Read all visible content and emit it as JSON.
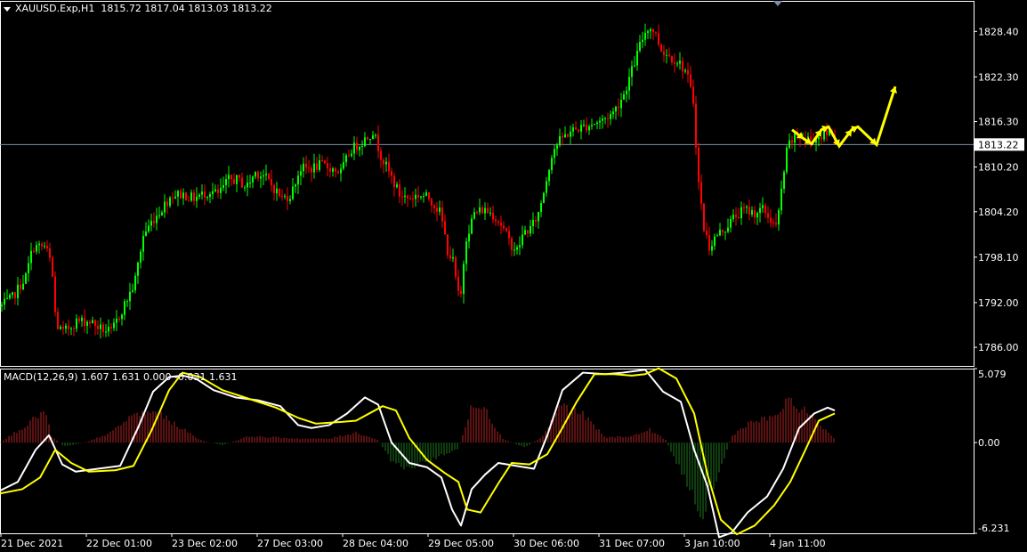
{
  "header": {
    "symbol": "XAUUSD.Exp,H1",
    "ohlc": "1815.72 1817.04 1813.03 1813.22"
  },
  "macd_header": {
    "text": "MACD(12,26,9) 1.607 1.631 0.000 -0.031 1.631"
  },
  "colors": {
    "background": "#000000",
    "bull": "#00ff00",
    "bear": "#ff0000",
    "macd_line": "#ffffff",
    "signal_line": "#ffff00",
    "hist_pos": "#b22222",
    "hist_neg": "#1e7a1e",
    "arrows": "#ffff00",
    "current_price_line": "#7f8fa6",
    "frame": "#ffffff"
  },
  "chart_data": [
    {
      "type": "candlestick",
      "title": "XAUUSD.Exp,H1",
      "ylim": [
        1783.5,
        1832.5
      ],
      "y_ticks": [
        "1828.40",
        "1822.30",
        "1816.30",
        "1810.20",
        "1804.20",
        "1798.10",
        "1792.00",
        "1786.00"
      ],
      "current_price": "1813.22",
      "x_ticks": [
        "21 Dec 2021",
        "22 Dec 01:00",
        "23 Dec 02:00",
        "27 Dec 03:00",
        "28 Dec 04:00",
        "29 Dec 05:00",
        "30 Dec 06:00",
        "31 Dec 07:00",
        "3 Jan 10:00",
        "4 Jan 11:00"
      ],
      "close_path": [
        [
          0,
          1791.5
        ],
        [
          12,
          1792.5
        ],
        [
          28,
          1795.5
        ],
        [
          36,
          1799.5
        ],
        [
          50,
          1799.5
        ],
        [
          57,
          1797.0
        ],
        [
          62,
          1789.0
        ],
        [
          70,
          1788.0
        ],
        [
          85,
          1789.5
        ],
        [
          100,
          1789.5
        ],
        [
          112,
          1788.5
        ],
        [
          124,
          1788.0
        ],
        [
          138,
          1791.5
        ],
        [
          150,
          1794.5
        ],
        [
          160,
          1801.0
        ],
        [
          170,
          1803.0
        ],
        [
          180,
          1804.5
        ],
        [
          192,
          1806.5
        ],
        [
          205,
          1806.5
        ],
        [
          216,
          1806.0
        ],
        [
          226,
          1806.5
        ],
        [
          236,
          1807.0
        ],
        [
          244,
          1806.5
        ],
        [
          256,
          1808.5
        ],
        [
          266,
          1808.5
        ],
        [
          276,
          1807.5
        ],
        [
          286,
          1809.5
        ],
        [
          296,
          1809.0
        ],
        [
          306,
          1807.5
        ],
        [
          316,
          1806.0
        ],
        [
          326,
          1806.5
        ],
        [
          336,
          1810.0
        ],
        [
          348,
          1810.0
        ],
        [
          360,
          1810.5
        ],
        [
          372,
          1810.0
        ],
        [
          382,
          1809.5
        ],
        [
          393,
          1812.5
        ],
        [
          405,
          1813.5
        ],
        [
          418,
          1815.0
        ],
        [
          428,
          1811.5
        ],
        [
          438,
          1809.0
        ],
        [
          448,
          1806.5
        ],
        [
          458,
          1806.0
        ],
        [
          470,
          1806.5
        ],
        [
          482,
          1806.0
        ],
        [
          494,
          1804.0
        ],
        [
          502,
          1799.0
        ],
        [
          508,
          1797.5
        ],
        [
          516,
          1791.5
        ],
        [
          522,
          1800.5
        ],
        [
          532,
          1804.0
        ],
        [
          542,
          1804.5
        ],
        [
          552,
          1804.0
        ],
        [
          562,
          1802.5
        ],
        [
          572,
          1800.0
        ],
        [
          580,
          1799.0
        ],
        [
          588,
          1801.5
        ],
        [
          596,
          1802.0
        ],
        [
          604,
          1804.0
        ],
        [
          612,
          1808.0
        ],
        [
          620,
          1812.5
        ],
        [
          630,
          1814.0
        ],
        [
          640,
          1815.0
        ],
        [
          652,
          1815.5
        ],
        [
          664,
          1816.0
        ],
        [
          676,
          1816.5
        ],
        [
          688,
          1817.5
        ],
        [
          700,
          1820.0
        ],
        [
          710,
          1823.5
        ],
        [
          718,
          1826.5
        ],
        [
          726,
          1829.0
        ],
        [
          734,
          1828.5
        ],
        [
          742,
          1826.0
        ],
        [
          752,
          1825.0
        ],
        [
          760,
          1824.5
        ],
        [
          770,
          1823.0
        ],
        [
          778,
          1819.0
        ],
        [
          784,
          1808.0
        ],
        [
          790,
          1802.0
        ],
        [
          796,
          1799.5
        ],
        [
          804,
          1801.0
        ],
        [
          814,
          1802.0
        ],
        [
          824,
          1803.5
        ],
        [
          836,
          1804.5
        ],
        [
          846,
          1804.0
        ],
        [
          856,
          1804.5
        ],
        [
          866,
          1803.0
        ],
        [
          872,
          1802.0
        ],
        [
          878,
          1808.0
        ],
        [
          884,
          1813.0
        ],
        [
          894,
          1814.5
        ],
        [
          904,
          1814.0
        ],
        [
          914,
          1814.0
        ],
        [
          924,
          1814.5
        ],
        [
          934,
          1815.0
        ],
        [
          938,
          1813.2
        ]
      ],
      "arrows": [
        [
          [
            890,
            1815.2
          ],
          [
            903,
            1814.0
          ],
          [
            912,
            1813.3
          ],
          [
            923,
            1815.2
          ],
          [
            931,
            1815.6
          ],
          [
            943,
            1813.0
          ],
          [
            957,
            1815.2
          ],
          [
            964,
            1815.6
          ],
          [
            985,
            1813.2
          ],
          [
            1006,
            1821.0
          ]
        ]
      ]
    },
    {
      "type": "line",
      "title": "MACD(12,26,9)",
      "ylim": [
        -6.231,
        5.079
      ],
      "y_ticks": [
        "5.079",
        "0.00",
        "-6.231"
      ],
      "series": [
        {
          "name": "MACD",
          "points": [
            [
              0,
              -3.3
            ],
            [
              20,
              -2.7
            ],
            [
              40,
              -0.5
            ],
            [
              55,
              0.5
            ],
            [
              70,
              -1.5
            ],
            [
              85,
              -2.0
            ],
            [
              110,
              -1.8
            ],
            [
              135,
              -1.6
            ],
            [
              155,
              1.0
            ],
            [
              172,
              3.5
            ],
            [
              190,
              4.5
            ],
            [
              205,
              4.6
            ],
            [
              220,
              4.4
            ],
            [
              240,
              3.6
            ],
            [
              265,
              3.1
            ],
            [
              290,
              2.9
            ],
            [
              315,
              2.5
            ],
            [
              335,
              1.2
            ],
            [
              350,
              1.0
            ],
            [
              370,
              1.2
            ],
            [
              390,
              2.0
            ],
            [
              410,
              3.1
            ],
            [
              425,
              2.6
            ],
            [
              440,
              0.0
            ],
            [
              460,
              -1.4
            ],
            [
              480,
              -1.7
            ],
            [
              496,
              -2.4
            ],
            [
              508,
              -4.6
            ],
            [
              518,
              -5.7
            ],
            [
              530,
              -3.2
            ],
            [
              545,
              -2.2
            ],
            [
              560,
              -1.4
            ],
            [
              580,
              -1.6
            ],
            [
              600,
              -1.8
            ],
            [
              615,
              0.5
            ],
            [
              632,
              3.6
            ],
            [
              655,
              4.8
            ],
            [
              680,
              4.7
            ],
            [
              700,
              4.8
            ],
            [
              725,
              5.0
            ],
            [
              745,
              3.5
            ],
            [
              765,
              2.8
            ],
            [
              780,
              -0.5
            ],
            [
              795,
              -3.0
            ],
            [
              808,
              -6.5
            ],
            [
              822,
              -6.2
            ],
            [
              840,
              -4.8
            ],
            [
              862,
              -3.7
            ],
            [
              880,
              -1.8
            ],
            [
              898,
              1.0
            ],
            [
              915,
              2.0
            ],
            [
              930,
              2.4
            ],
            [
              938,
              2.2
            ]
          ]
        },
        {
          "name": "Signal",
          "points": [
            [
              0,
              -3.5
            ],
            [
              25,
              -3.2
            ],
            [
              45,
              -2.4
            ],
            [
              62,
              -0.5
            ],
            [
              80,
              -1.4
            ],
            [
              100,
              -2.0
            ],
            [
              130,
              -1.9
            ],
            [
              150,
              -1.6
            ],
            [
              170,
              0.8
            ],
            [
              190,
              3.6
            ],
            [
              205,
              4.8
            ],
            [
              225,
              4.5
            ],
            [
              250,
              3.6
            ],
            [
              280,
              3.0
            ],
            [
              310,
              2.4
            ],
            [
              335,
              1.7
            ],
            [
              355,
              1.3
            ],
            [
              380,
              1.4
            ],
            [
              400,
              1.5
            ],
            [
              430,
              2.5
            ],
            [
              445,
              2.2
            ],
            [
              460,
              0.3
            ],
            [
              480,
              -1.2
            ],
            [
              500,
              -2.1
            ],
            [
              515,
              -2.7
            ],
            [
              525,
              -4.6
            ],
            [
              540,
              -4.8
            ],
            [
              560,
              -2.8
            ],
            [
              575,
              -1.4
            ],
            [
              595,
              -1.5
            ],
            [
              615,
              -0.8
            ],
            [
              630,
              0.8
            ],
            [
              648,
              2.8
            ],
            [
              668,
              4.7
            ],
            [
              690,
              4.7
            ],
            [
              710,
              4.6
            ],
            [
              725,
              4.7
            ],
            [
              740,
              5.1
            ],
            [
              760,
              4.4
            ],
            [
              780,
              2.0
            ],
            [
              795,
              -2.2
            ],
            [
              810,
              -5.3
            ],
            [
              828,
              -6.3
            ],
            [
              848,
              -5.7
            ],
            [
              870,
              -4.3
            ],
            [
              888,
              -2.7
            ],
            [
              905,
              -0.5
            ],
            [
              920,
              1.5
            ],
            [
              938,
              2.0
            ]
          ]
        }
      ],
      "histogram_envelope": [
        [
          0,
          0.0
        ],
        [
          30,
          1.4
        ],
        [
          50,
          2.5
        ],
        [
          58,
          0.5
        ],
        [
          72,
          -0.3
        ],
        [
          100,
          0.1
        ],
        [
          125,
          0.8
        ],
        [
          150,
          2.2
        ],
        [
          175,
          2.4
        ],
        [
          200,
          1.3
        ],
        [
          225,
          0.2
        ],
        [
          250,
          -0.2
        ],
        [
          280,
          0.5
        ],
        [
          310,
          0.4
        ],
        [
          340,
          0.3
        ],
        [
          370,
          0.3
        ],
        [
          400,
          0.8
        ],
        [
          425,
          0.2
        ],
        [
          440,
          -1.5
        ],
        [
          460,
          -2.0
        ],
        [
          490,
          -1.2
        ],
        [
          515,
          -0.5
        ],
        [
          530,
          2.8
        ],
        [
          545,
          2.6
        ],
        [
          565,
          0.3
        ],
        [
          590,
          -0.4
        ],
        [
          610,
          0.5
        ],
        [
          630,
          3.0
        ],
        [
          655,
          2.2
        ],
        [
          680,
          0.4
        ],
        [
          710,
          0.5
        ],
        [
          730,
          1.0
        ],
        [
          748,
          0.2
        ],
        [
          770,
          -3.0
        ],
        [
          790,
          -5.5
        ],
        [
          810,
          -2.0
        ],
        [
          822,
          0.5
        ],
        [
          840,
          1.5
        ],
        [
          870,
          2.0
        ],
        [
          885,
          3.2
        ],
        [
          905,
          2.5
        ],
        [
          920,
          1.5
        ],
        [
          938,
          0.3
        ]
      ]
    }
  ]
}
